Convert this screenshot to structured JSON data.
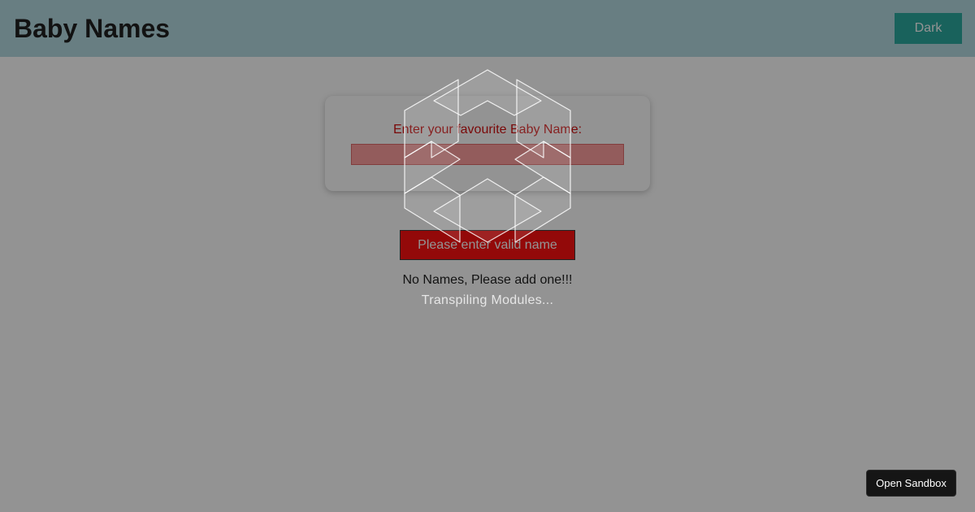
{
  "header": {
    "title": "Baby Names",
    "theme_button_label": "Dark"
  },
  "form": {
    "label": "Enter your favourite Baby Name:",
    "input_value": "",
    "submit_label": "Please enter valid name"
  },
  "list": {
    "empty_message": "No Names, Please add one!!!"
  },
  "overlay": {
    "loading_text": "Transpiling Modules...",
    "logo_icon": "codesandbox-logo-icon",
    "open_sandbox_label": "Open Sandbox"
  },
  "colors": {
    "header_bg": "#b0d8e0",
    "accent_teal": "#1fa59a",
    "error_red": "#ff0000",
    "label_red": "#d10000"
  }
}
